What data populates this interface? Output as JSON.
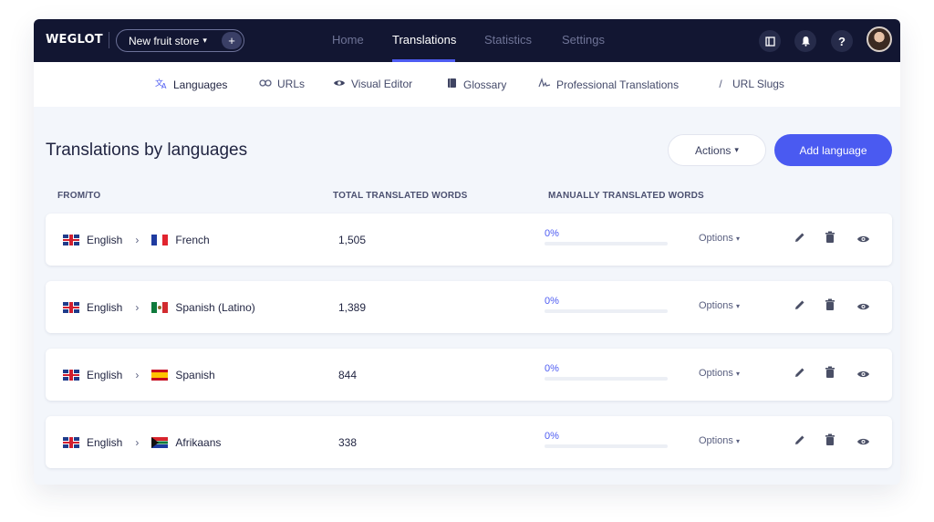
{
  "app": {
    "logo": "WEGLOT",
    "project": "New fruit store",
    "project_add": "+"
  },
  "topnav": {
    "items": [
      "Home",
      "Translations",
      "Statistics",
      "Settings"
    ],
    "active": "Translations"
  },
  "topbar_icons": [
    "sidebar-toggle-icon",
    "bell-icon",
    "help-icon"
  ],
  "help_glyph": "?",
  "subnav": {
    "items": [
      {
        "label": "Languages",
        "icon": "translate-icon"
      },
      {
        "label": "URLs",
        "icon": "link-icon"
      },
      {
        "label": "Visual Editor",
        "icon": "eye-icon"
      },
      {
        "label": "Glossary",
        "icon": "book-icon"
      },
      {
        "label": "Professional Translations",
        "icon": "signature-icon"
      },
      {
        "label": "URL Slugs",
        "icon": "slash-icon"
      }
    ],
    "active": "Languages"
  },
  "main": {
    "title": "Translations by languages",
    "actions_label": "Actions",
    "add_label": "Add language",
    "columns": [
      "FROM/TO",
      "TOTAL TRANSLATED WORDS",
      "MANUALLY TRANSLATED WORDS"
    ]
  },
  "rows": [
    {
      "from": "English",
      "to": "French",
      "to_flag": "fr",
      "total": "1,505",
      "manual_pct": "0%",
      "manual_fraction": 0,
      "options": "Options"
    },
    {
      "from": "English",
      "to": "Spanish (Latino)",
      "to_flag": "mx",
      "total": "1,389",
      "manual_pct": "0%",
      "manual_fraction": 0,
      "options": "Options"
    },
    {
      "from": "English",
      "to": "Spanish",
      "to_flag": "es",
      "total": "844",
      "manual_pct": "0%",
      "manual_fraction": 0,
      "options": "Options"
    },
    {
      "from": "English",
      "to": "Afrikaans",
      "to_flag": "za",
      "total": "338",
      "manual_pct": "0%",
      "manual_fraction": 0,
      "options": "Options"
    }
  ],
  "colors": {
    "nav_bg": "#121632",
    "accent": "#4e5cf2",
    "page_bg": "#f3f6fb"
  }
}
